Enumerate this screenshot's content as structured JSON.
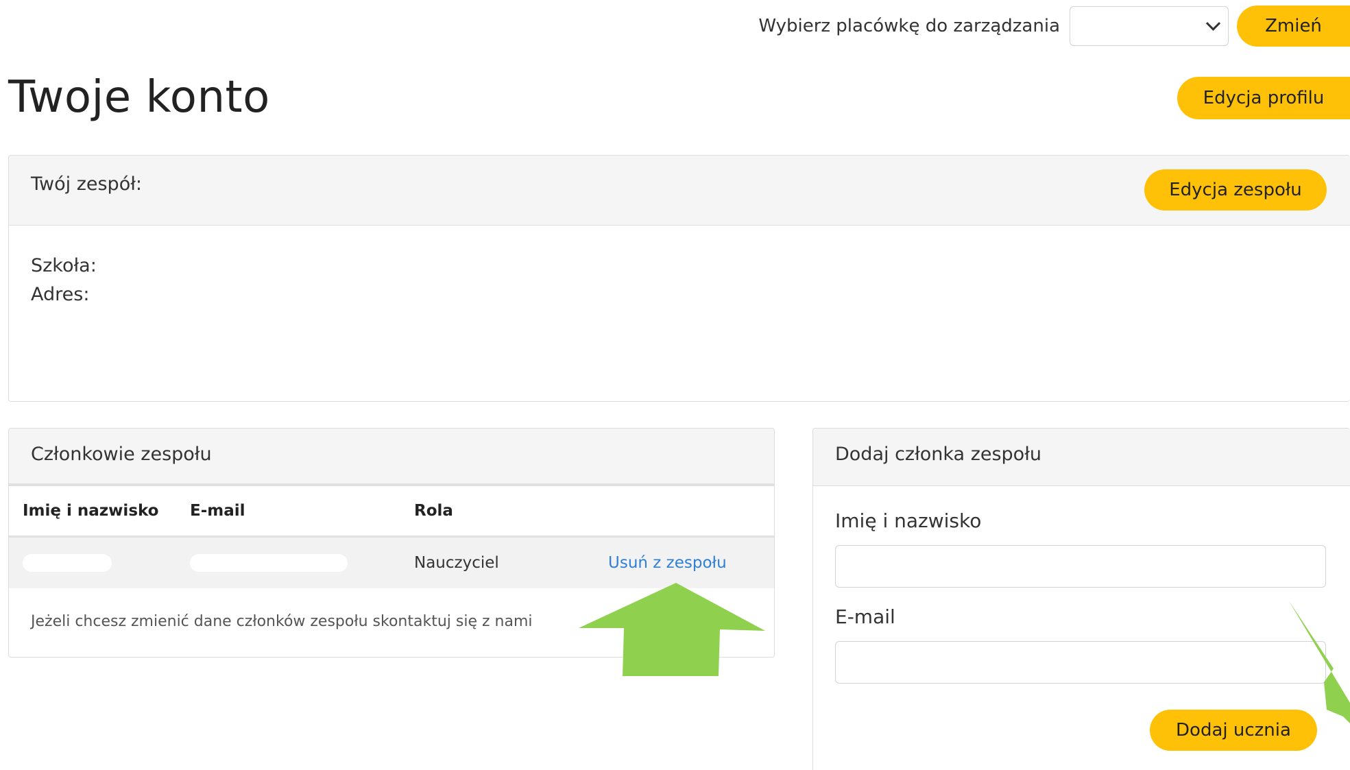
{
  "topbar": {
    "label": "Wybierz placówkę do zarządzania",
    "select_value": "",
    "change_button": "Zmień"
  },
  "page": {
    "title": "Twoje konto",
    "edit_profile_button": "Edycja profilu"
  },
  "team": {
    "label": "Twój zespół:",
    "name": "",
    "edit_team_button": "Edycja zespołu",
    "school_label": "Szkoła:",
    "school_value": "",
    "address_label": "Adres:",
    "address_value": ""
  },
  "members": {
    "title": "Członkowie zespołu",
    "columns": [
      "Imię i nazwisko",
      "E-mail",
      "Rola",
      ""
    ],
    "rows": [
      {
        "name": "",
        "email": "",
        "role": "Nauczyciel",
        "action": "Usuń z zespołu"
      }
    ],
    "note": "Jeżeli chcesz zmienić dane członków zespołu skontaktuj się z nami"
  },
  "add_member": {
    "title": "Dodaj członka zespołu",
    "name_label": "Imię i nazwisko",
    "name_value": "",
    "email_label": "E-mail",
    "email_value": "",
    "submit_button": "Dodaj ucznia"
  },
  "colors": {
    "accent": "#ffc107",
    "link": "#2f80d8",
    "arrow": "#8fd14f",
    "card_header_bg": "#f5f5f5"
  },
  "icons": {
    "select_chevron": "chevron-down-icon",
    "annotation_arrows": "arrow-annotation"
  }
}
